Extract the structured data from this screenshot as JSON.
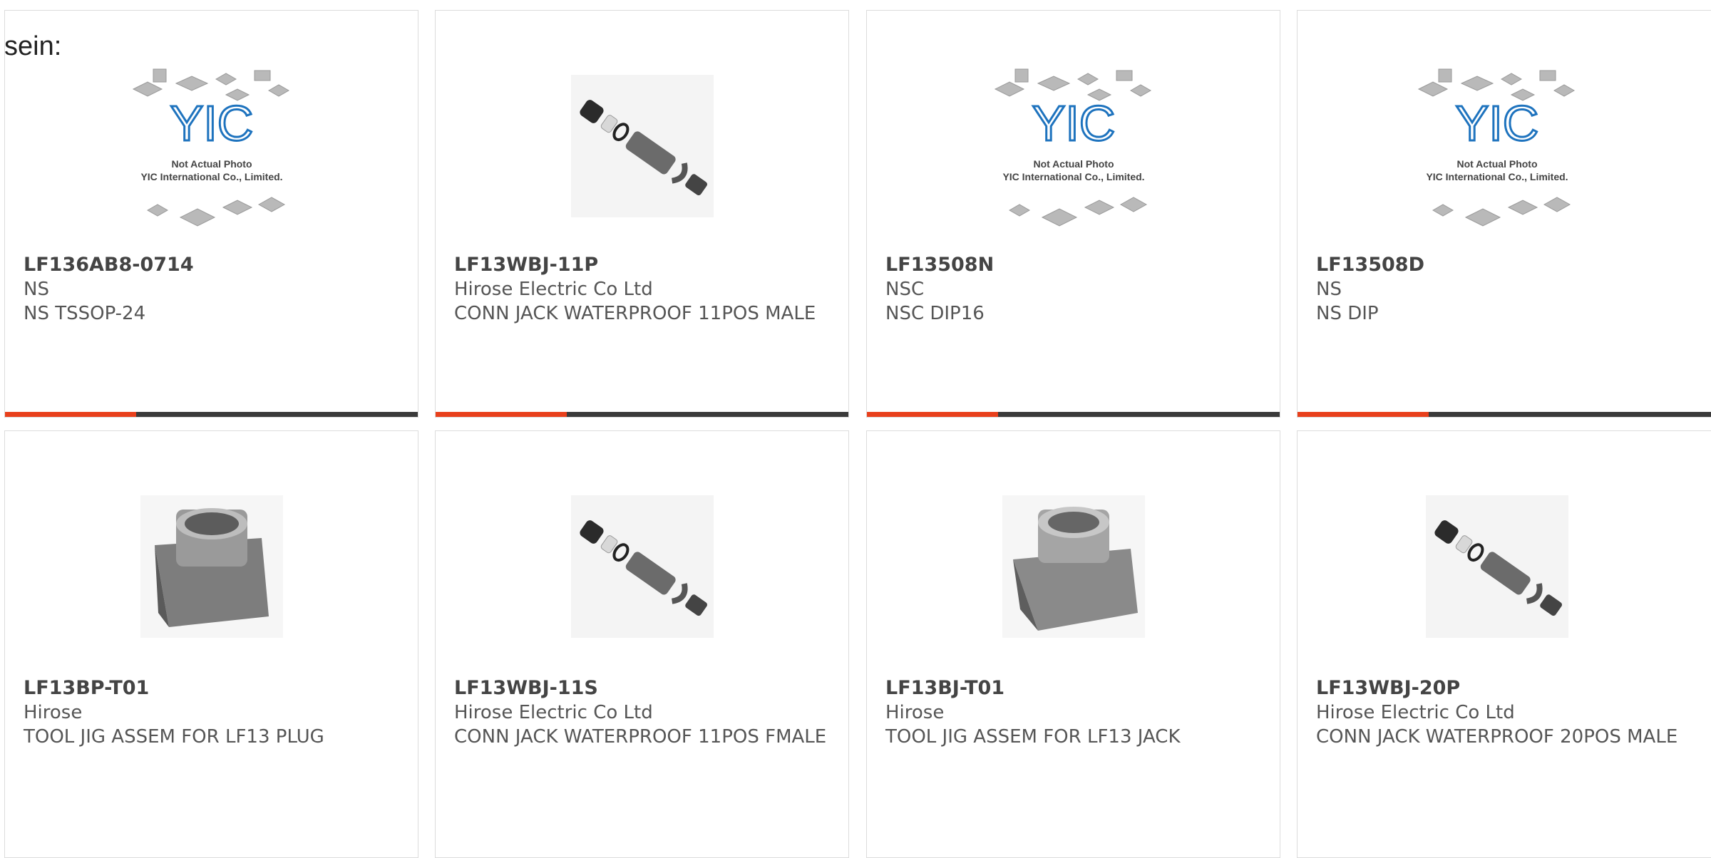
{
  "stray_text": "sein:",
  "yic_placeholder": {
    "logo": "YIC",
    "line1": "Not Actual Photo",
    "line2": "YIC International Co., Limited."
  },
  "products": [
    {
      "part": "LF136AB8-0714",
      "manufacturer": "NS",
      "description": "NS TSSOP-24",
      "image": "yic-placeholder-image"
    },
    {
      "part": "LF13WBJ-11P",
      "manufacturer": "Hirose Electric Co Ltd",
      "description": "CONN JACK WATERPROOF 11POS MALE",
      "image": "connector-kit-image"
    },
    {
      "part": "LF13508N",
      "manufacturer": "NSC",
      "description": "NSC DIP16",
      "image": "yic-placeholder-image"
    },
    {
      "part": "LF13508D",
      "manufacturer": "NS",
      "description": "NS DIP",
      "image": "yic-placeholder-image"
    },
    {
      "part": "LF13BP-T01",
      "manufacturer": "Hirose",
      "description": "TOOL JIG ASSEM FOR LF13 PLUG",
      "image": "jig-tool-image"
    },
    {
      "part": "LF13WBJ-11S",
      "manufacturer": "Hirose Electric Co Ltd",
      "description": "CONN JACK WATERPROOF 11POS FMALE",
      "image": "connector-kit-image"
    },
    {
      "part": "LF13BJ-T01",
      "manufacturer": "Hirose",
      "description": "TOOL JIG ASSEM FOR LF13 JACK",
      "image": "jig-tool-image"
    },
    {
      "part": "LF13WBJ-20P",
      "manufacturer": "Hirose Electric Co Ltd",
      "description": "CONN JACK WATERPROOF 20POS MALE",
      "image": "connector-kit-image"
    }
  ],
  "colors": {
    "accent": "#e8401c",
    "bar": "#3a3a3a",
    "logo_blue": "#1e73be"
  }
}
